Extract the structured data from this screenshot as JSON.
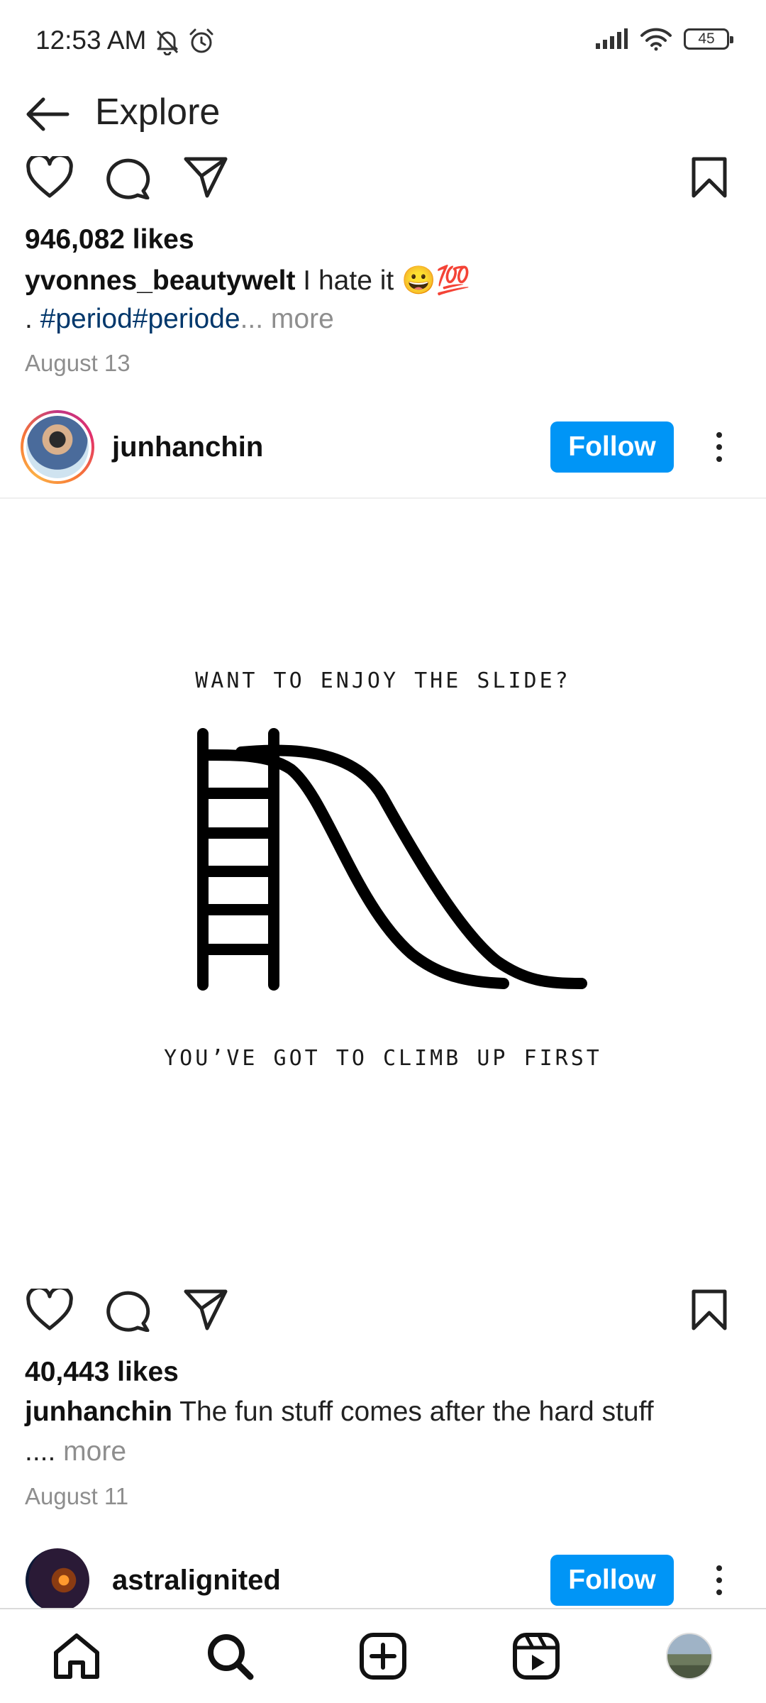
{
  "status_bar": {
    "time": "12:53 AM",
    "battery": "45"
  },
  "header": {
    "title": "Explore"
  },
  "post1": {
    "likes": "946,082 likes",
    "username": "yvonnes_beautywelt",
    "caption": " I hate it 😀💯",
    "caption_line2_prefix": ". ",
    "hashtags": "#period#periode",
    "more": "... more",
    "date": "August 13"
  },
  "post2": {
    "username": "junhanchin",
    "follow_label": "Follow",
    "image_text_top": "WANT TO ENJOY THE SLIDE?",
    "image_text_bottom": "YOU’VE GOT TO CLIMB UP FIRST",
    "likes": "40,443 likes",
    "caption_user": "junhanchin",
    "caption": " The fun stuff comes after the hard stuff",
    "caption_line2_prefix": "....",
    "more": " more",
    "date": "August 11"
  },
  "post3": {
    "username": "astralignited",
    "follow_label": "Follow"
  },
  "bottom_nav": {
    "items": [
      "home-icon",
      "search-icon",
      "create-icon",
      "reels-icon",
      "profile-avatar"
    ]
  },
  "colors": {
    "accent": "#0095f6",
    "hashtag": "#00376b",
    "muted": "#8e8e8e"
  }
}
